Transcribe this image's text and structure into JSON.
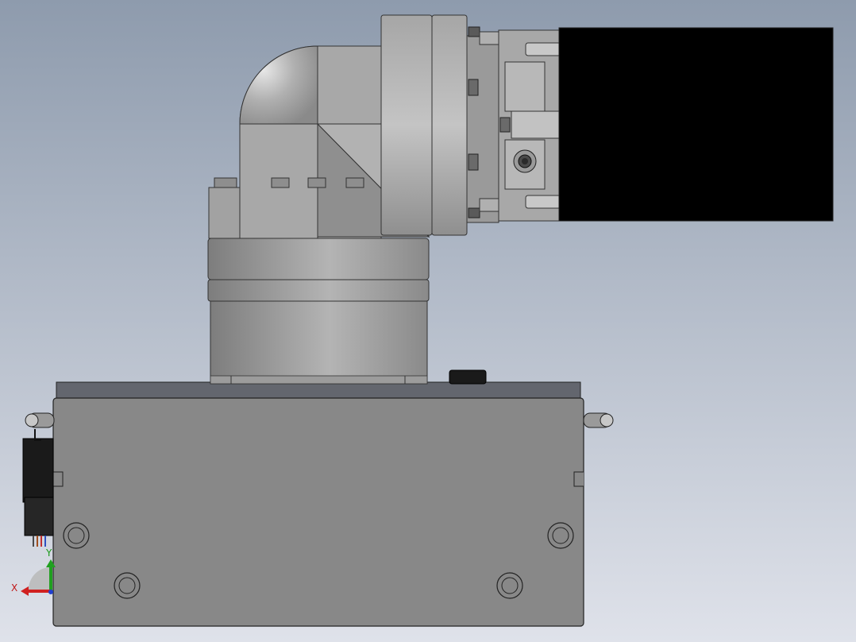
{
  "viewport": {
    "background_top": "#8e9bad",
    "background_bottom": "#dfe2ea"
  },
  "triad": {
    "x_label": "X",
    "y_label": "Y",
    "x_color": "#d02020",
    "y_color": "#20a020",
    "z_color": "#2040d0"
  },
  "gripper_block": {
    "color": "#000000"
  }
}
